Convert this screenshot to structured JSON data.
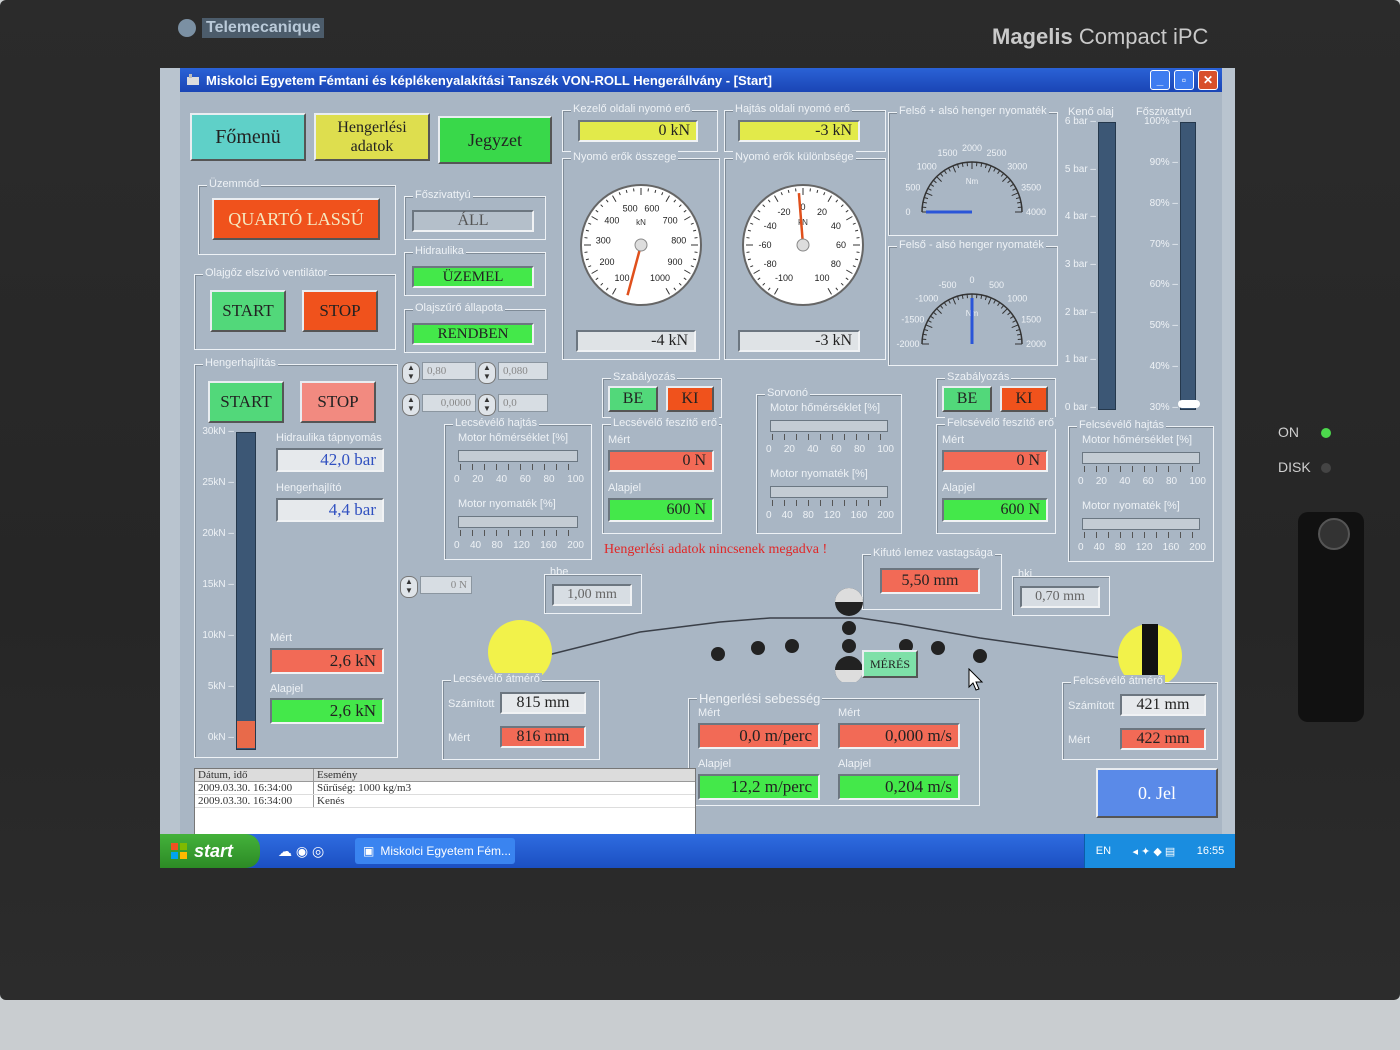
{
  "bezel": {
    "brand_left": "Telemecanique",
    "brand_right_bold": "Magelis",
    "brand_right": "Compact iPC",
    "led_on": "ON",
    "led_disk": "DISK"
  },
  "window": {
    "title": "Miskolci Egyetem Fémtani és képlékenyalakítási Tanszék VON-ROLL Hengerállvány - [Start]",
    "minimize": "_",
    "maximize": "▫",
    "close": "✕"
  },
  "nav": {
    "fomenu": "Főmenü",
    "hengerlesi_adatok_1": "Hengerlési",
    "hengerlesi_adatok_2": "adatok",
    "jegyzet": "Jegyzet"
  },
  "uzemmod": {
    "label": "Üzemmód",
    "value": "QUARTÓ LASSÚ"
  },
  "olajgoz": {
    "label": "Olajgőz elszívó ventilátor",
    "start": "START",
    "stop": "STOP"
  },
  "hengerhajlitas": {
    "label": "Hengerhajlítás",
    "start": "START",
    "stop": "STOP"
  },
  "foszivattyu": {
    "label": "Főszivattyú",
    "value": "ÁLL"
  },
  "hidraulika": {
    "label": "Hidraulika",
    "value": "ÜZEMEL"
  },
  "olajszuro": {
    "label": "Olajszűrő állapota",
    "value": "RENDBEN"
  },
  "mini_fields": {
    "a": "0,80",
    "b": "0,080",
    "c": "0,0000",
    "d": "0,0",
    "e": "0 N"
  },
  "force_left": {
    "title": "Hengerhajlítás",
    "scale": [
      "30kN",
      "25kN",
      "20kN",
      "15kN",
      "10kN",
      "5kN",
      "0kN"
    ],
    "hidraulika_label": "Hidraulika tápnyomás",
    "hidraulika_value": "42,0 bar",
    "hengerhajlito_label": "Hengerhajlító",
    "hengerhajlito_value": "4,4 bar",
    "mert_label": "Mért",
    "mert_value": "2,6 kN",
    "alapjel_label": "Alapjel",
    "alapjel_value": "2,6 kN",
    "level": 0.087
  },
  "kezelo": {
    "label": "Kezelő oldali nyomó erő",
    "value": "0 kN"
  },
  "hajtas": {
    "label": "Hajtás oldali nyomó erő",
    "value": "-3 kN"
  },
  "nyomo_osszege": {
    "label": "Nyomó erők összege",
    "value": "-4 kN",
    "unit": "kN",
    "ticks": [
      "100",
      "200",
      "300",
      "400",
      "500",
      "600",
      "700",
      "800",
      "900",
      "1000"
    ]
  },
  "nyomo_kulonbsege": {
    "label": "Nyomó erők különbsége",
    "value": "-3 kN",
    "unit": "kN",
    "ticks": [
      "-100",
      "-80",
      "-60",
      "-40",
      "-20",
      "0",
      "20",
      "40",
      "60",
      "80",
      "100"
    ]
  },
  "felso_also_1": {
    "label": "Felső + alsó henger nyomaték",
    "unit": "Nm",
    "ticks": [
      "0",
      "500",
      "1000",
      "1500",
      "2000",
      "2500",
      "3000",
      "3500",
      "4000"
    ]
  },
  "felso_also_2": {
    "label": "Felső - alsó henger nyomaték",
    "unit": "Nm",
    "ticks": [
      "-2000",
      "-1500",
      "-1000",
      "-500",
      "0",
      "500",
      "1000",
      "1500",
      "2000"
    ]
  },
  "keno_olaj": {
    "label": "Kenő olaj",
    "scale": [
      "6 bar",
      "5 bar",
      "4 bar",
      "3 bar",
      "2 bar",
      "1 bar",
      "0 bar"
    ]
  },
  "foszivattyu_bar": {
    "label": "Főszivattyú",
    "scale": [
      "100%",
      "90%",
      "80%",
      "70%",
      "60%",
      "50%",
      "40%",
      "30%"
    ]
  },
  "szab_left": {
    "label": "Szabályozás",
    "be": "BE",
    "ki": "KI"
  },
  "szab_right": {
    "label": "Szabályozás",
    "be": "BE",
    "ki": "KI"
  },
  "lecs_hajtas": {
    "label": "Lecsévélő hajtás",
    "homerseklet": "Motor hőmérséklet [%]",
    "scale1": [
      "0",
      "20",
      "40",
      "60",
      "80",
      "100"
    ],
    "nyomatek": "Motor nyomaték [%]",
    "scale2": [
      "0",
      "40",
      "80",
      "120",
      "160",
      "200"
    ]
  },
  "sorvono": {
    "label": "Sorvonó",
    "homerseklet": "Motor hőmérséklet [%]",
    "scale1": [
      "0",
      "20",
      "40",
      "60",
      "80",
      "100"
    ],
    "nyomatek": "Motor nyomaték [%]",
    "scale2": [
      "0",
      "40",
      "80",
      "120",
      "160",
      "200"
    ]
  },
  "felcs_hajtas": {
    "label": "Felcsévélő hajtás",
    "homerseklet": "Motor hőmérséklet [%]",
    "scale1": [
      "0",
      "20",
      "40",
      "60",
      "80",
      "100"
    ],
    "nyomatek": "Motor nyomaték [%]",
    "scale2": [
      "0",
      "40",
      "80",
      "120",
      "160",
      "200"
    ]
  },
  "lecs_feszito": {
    "label": "Lecsévélő feszítő erő",
    "mert_label": "Mért",
    "mert": "0 N",
    "alapjel_label": "Alapjel",
    "alapjel": "600 N"
  },
  "felcs_feszito": {
    "label": "Felcsévélő feszítő erő",
    "mert_label": "Mért",
    "mert": "0 N",
    "alapjel_label": "Alapjel",
    "alapjel": "600 N"
  },
  "warning": "Hengerlési adatok nincsenek megadva !",
  "kifuto": {
    "label": "Kifutó lemez vastagsága",
    "value": "5,50  mm"
  },
  "hbe": {
    "label": "hbe",
    "value": "1,00  mm"
  },
  "hki": {
    "label": "hki",
    "value": "0,70  mm"
  },
  "meres": "MÉRÉS",
  "lecs_atmero": {
    "label": "Lecsévélő átmérő",
    "szamitott_label": "Számított",
    "szamitott": "815  mm",
    "mert_label": "Mért",
    "mert": "816  mm"
  },
  "felcs_atmero": {
    "label": "Felcsévélő átmérő",
    "szamitott_label": "Számított",
    "szamitott": "421  mm",
    "mert_label": "Mért",
    "mert": "422  mm"
  },
  "sebesseg": {
    "label": "Hengerlési sebesség",
    "mert_label": "Mért",
    "mert1": "0,0 m/perc",
    "mert2": "0,000 m/s",
    "alapjel_label": "Alapjel",
    "alapjel1": "12,2 m/perc",
    "alapjel2": "0,204 m/s"
  },
  "jel": "0. Jel",
  "log": {
    "col1": "Dátum, idő",
    "col2": "Esemény",
    "rows": [
      {
        "t": "2009.03.30. 16:34:00",
        "e": "Sűrűség: 1000 kg/m3"
      },
      {
        "t": "2009.03.30. 16:34:00",
        "e": "Kenés"
      }
    ]
  },
  "taskbar": {
    "start": "start",
    "task": "Miskolci Egyetem Fém...",
    "lang": "EN",
    "clock": "16:55"
  }
}
